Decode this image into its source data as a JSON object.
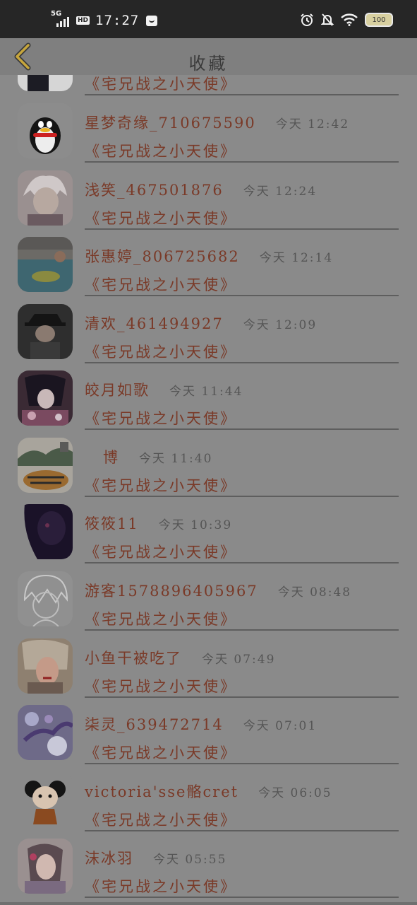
{
  "status": {
    "network": "5G",
    "hd": "HD",
    "time": "17:27",
    "battery": "100",
    "icons": [
      "shopping-bag-icon",
      "alarm-icon",
      "mute-bell-icon",
      "wifi-icon",
      "battery-icon"
    ]
  },
  "header": {
    "title": "收藏",
    "back_icon": "chevron-left-icon"
  },
  "colors": {
    "accent_text": "#7a3a28",
    "back_arrow": "#c7a63c",
    "statusbar": "#262626"
  },
  "items": [
    {
      "name": "",
      "time": "",
      "book": "《宅兄战之小天使》"
    },
    {
      "name": "星梦奇缘_710675590",
      "time": "今天 12:42",
      "book": "《宅兄战之小天使》"
    },
    {
      "name": "浅笑_467501876",
      "time": "今天 12:24",
      "book": "《宅兄战之小天使》"
    },
    {
      "name": "张惠婷_806725682",
      "time": "今天 12:14",
      "book": "《宅兄战之小天使》"
    },
    {
      "name": "清欢_461494927",
      "time": "今天 12:09",
      "book": "《宅兄战之小天使》"
    },
    {
      "name": "皎月如歌",
      "time": "今天 11:44",
      "book": "《宅兄战之小天使》"
    },
    {
      "name": "博",
      "time": "今天 11:40",
      "book": "《宅兄战之小天使》"
    },
    {
      "name": "筱筱11",
      "time": "今天 10:39",
      "book": "《宅兄战之小天使》"
    },
    {
      "name": "游客1578896405967",
      "time": "今天 08:48",
      "book": "《宅兄战之小天使》"
    },
    {
      "name": "小鱼干被吃了",
      "time": "今天 07:49",
      "book": "《宅兄战之小天使》"
    },
    {
      "name": "柒灵_639472714",
      "time": "今天 07:01",
      "book": "《宅兄战之小天使》"
    },
    {
      "name": "victoria'sse骼cret",
      "time": "今天 06:05",
      "book": "《宅兄战之小天使》"
    },
    {
      "name": "沫冰羽",
      "time": "今天 05:55",
      "book": "《宅兄战之小天使》"
    }
  ]
}
